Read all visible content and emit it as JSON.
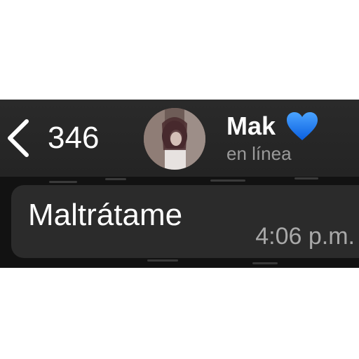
{
  "header": {
    "back_count": "346",
    "contact_name": "Mak",
    "contact_status": "en línea",
    "name_emoji": "blue-heart-icon"
  },
  "message": {
    "text": "Maltrátame",
    "time": "4:06 p.m."
  },
  "colors": {
    "header_bg": "#262626",
    "chat_bg": "#121212",
    "bubble_bg": "#2b2b2b",
    "status_text": "#9a9a9a",
    "heart": "#1a7bff"
  }
}
